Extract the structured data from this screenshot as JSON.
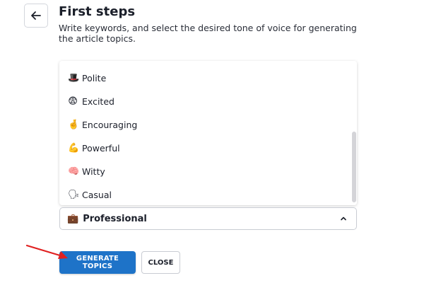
{
  "header": {
    "title": "First steps",
    "subtitle": "Write keywords, and select the desired tone of voice for generating the article topics."
  },
  "tone_list": {
    "options": [
      {
        "emoji": "🎩",
        "label": "Polite"
      },
      {
        "emoji": "😨",
        "label": "Excited"
      },
      {
        "emoji": "🤞",
        "label": "Encouraging"
      },
      {
        "emoji": "💪",
        "label": "Powerful"
      },
      {
        "emoji": "🧠",
        "label": "Witty"
      },
      {
        "emoji": "🗣",
        "label": "Casual"
      }
    ]
  },
  "tone_select": {
    "emoji": "💼",
    "value": "Professional"
  },
  "actions": {
    "generate_label": "GENERATE TOPICS",
    "close_label": "CLOSE"
  },
  "colors": {
    "primary": "#1e73c8",
    "annotation_arrow": "#e02020"
  },
  "icons": {
    "back": "arrow-left-icon",
    "select": "chevron-up-icon"
  }
}
